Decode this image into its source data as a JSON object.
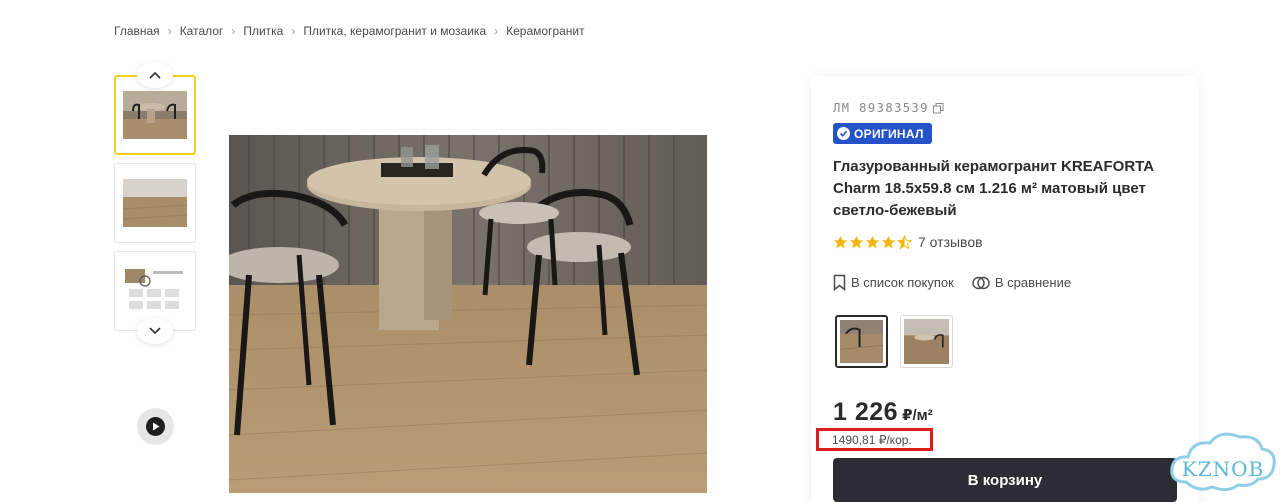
{
  "breadcrumb": [
    {
      "label": "Главная"
    },
    {
      "label": "Каталог"
    },
    {
      "label": "Плитка"
    },
    {
      "label": "Плитка, керамогранит и мозаика"
    },
    {
      "label": "Керамогранит"
    }
  ],
  "product": {
    "sku": "ЛМ 89383539",
    "badge": "ОРИГИНАЛ",
    "title": "Глазурованный керамогранит KREAFORTA Charm 18.5x59.8 см 1.216 м² матовый цвет светло-бежевый",
    "rating": 4.5,
    "reviews": "7 отзывов",
    "wishlist_label": "В список покупок",
    "compare_label": "В сравнение",
    "price": "1 226",
    "price_unit": "₽/м²",
    "box_price": "1490,81 ₽/кор.",
    "cart_label": "В корзину"
  },
  "watermark": "KZNOB",
  "colors": {
    "accent_yellow": "#f4d11e",
    "badge_blue": "#2452c8",
    "button_dark": "#2a2d33",
    "highlight_red": "#e01b1b",
    "star": "#f2b705"
  }
}
